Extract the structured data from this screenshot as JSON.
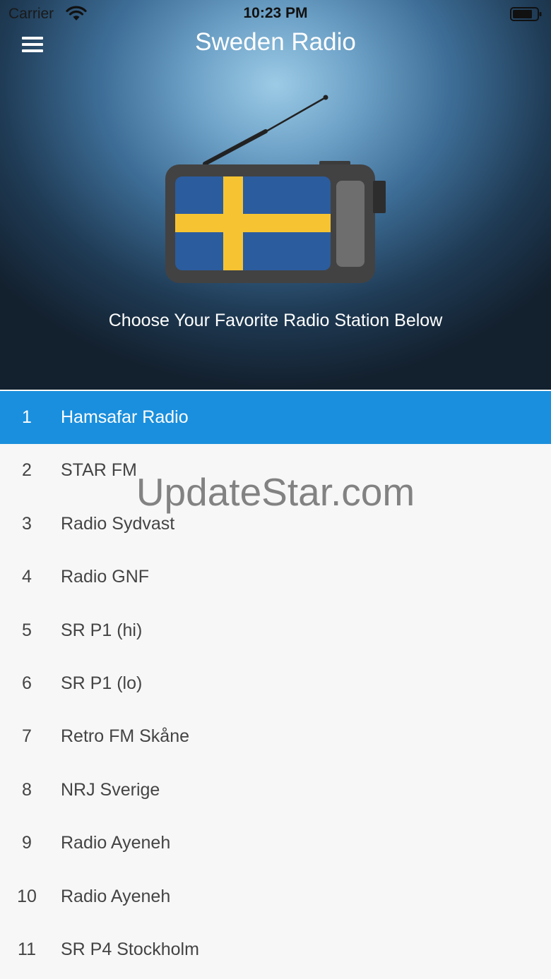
{
  "status_bar": {
    "carrier": "Carrier",
    "time": "10:23 PM"
  },
  "header": {
    "title": "Sweden Radio",
    "subtitle": "Choose Your Favorite Radio Station Below"
  },
  "colors": {
    "selected_row": "#1a8fdd",
    "flag_blue": "#2b5c9e",
    "flag_yellow": "#f6c432"
  },
  "icons": {
    "menu": "hamburger-menu-icon",
    "wifi": "wifi-icon",
    "battery": "battery-icon"
  },
  "stations": [
    {
      "num": "1",
      "name": "Hamsafar Radio",
      "selected": true
    },
    {
      "num": "2",
      "name": "STAR FM"
    },
    {
      "num": "3",
      "name": "Radio Sydvast"
    },
    {
      "num": "4",
      "name": "Radio GNF"
    },
    {
      "num": "5",
      "name": "SR P1 (hi)"
    },
    {
      "num": "6",
      "name": "SR P1 (lo)"
    },
    {
      "num": "7",
      "name": "Retro FM Skåne"
    },
    {
      "num": "8",
      "name": "NRJ Sverige"
    },
    {
      "num": "9",
      "name": "Radio Ayeneh"
    },
    {
      "num": "10",
      "name": "Radio Ayeneh"
    },
    {
      "num": "11",
      "name": "SR P4 Stockholm"
    }
  ],
  "watermark": "UpdateStar.com"
}
